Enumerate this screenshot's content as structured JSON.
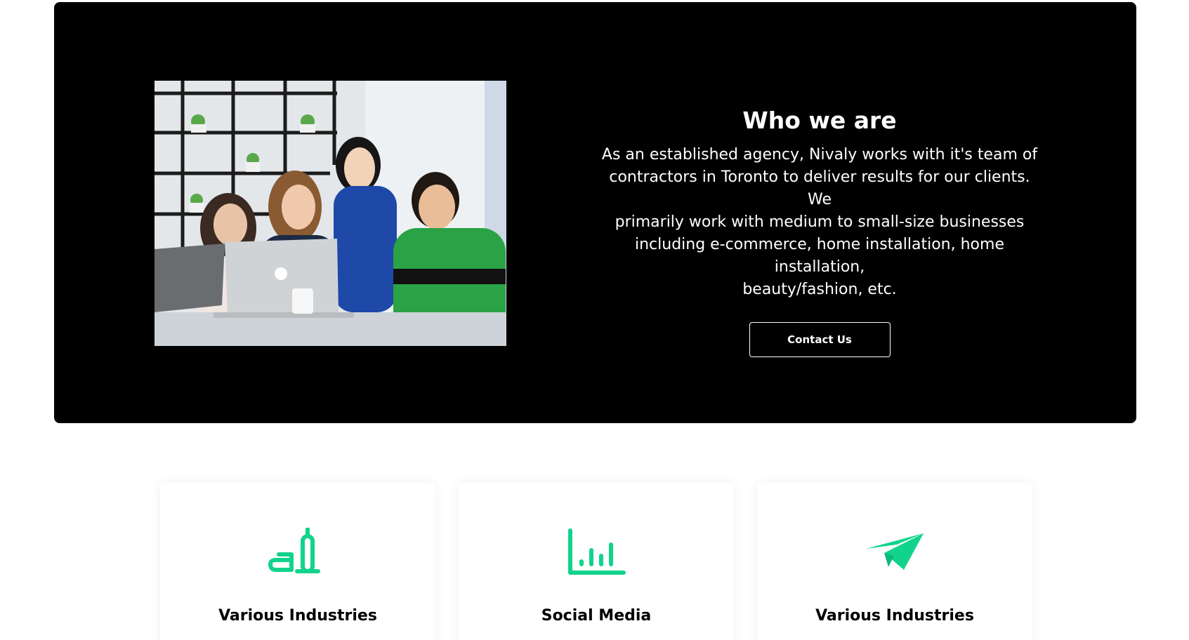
{
  "about": {
    "title": "Who we are",
    "lines": [
      "As an established agency, Nivaly works with it's team of",
      "contractors in Toronto to deliver results for our clients. We",
      "primarily work with medium to small-size businesses",
      "including e-commerce, home installation, home installation,",
      "beauty/fashion, etc."
    ],
    "contact_label": "Contact Us"
  },
  "features": [
    {
      "title": "Various Industries",
      "icon": "pen-writing-icon"
    },
    {
      "title": "Social Media",
      "icon": "bar-chart-icon"
    },
    {
      "title": "Various Industries",
      "icon": "paper-plane-icon"
    }
  ],
  "colors": {
    "accent": "#12d38c",
    "hero_bg": "#000000",
    "text_light": "#ffffff",
    "text_dark": "#000000"
  }
}
